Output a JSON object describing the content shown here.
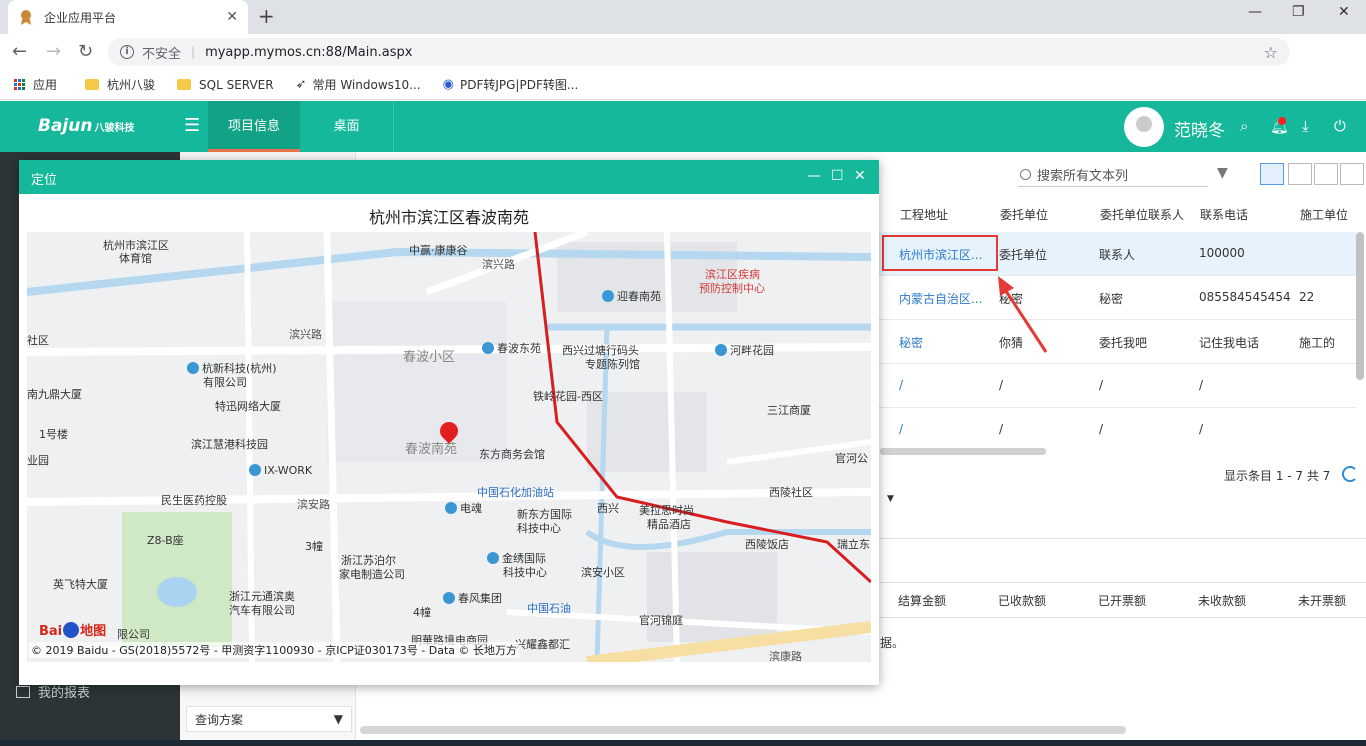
{
  "browser": {
    "tab_title": "企业应用平台",
    "new_tab": "+",
    "security_label": "不安全",
    "url": "myapp.mymos.cn:88/Main.aspx",
    "bookmarks": [
      {
        "label": "应用",
        "icon": "apps-grid-icon"
      },
      {
        "label": "杭州八骏",
        "icon": "folder-icon"
      },
      {
        "label": "SQL SERVER",
        "icon": "folder-icon"
      },
      {
        "label": "常用 Windows10...",
        "icon": "link-icon"
      },
      {
        "label": "PDF转JPG|PDF转图...",
        "icon": "pdf-site-icon"
      }
    ]
  },
  "header": {
    "logo_text": "Bajun",
    "logo_sub": "八骏科技",
    "tabs": [
      "项目信息",
      "桌面"
    ],
    "active_tab": "项目信息",
    "username": "范晓冬",
    "accent": "#15b89a"
  },
  "leftnav": {
    "report_item": "我的报表"
  },
  "secondpanel": {
    "query_select": "查询方案"
  },
  "toolbar": {
    "search_placeholder": "搜索所有文本列"
  },
  "table": {
    "columns": [
      "工程地址",
      "委托单位",
      "委托单位联系人",
      "联系电话",
      "施工单位"
    ],
    "rows": [
      [
        "杭州市滨江区...",
        "委托单位",
        "联系人",
        "100000",
        ""
      ],
      [
        "内蒙古自治区...",
        "秘密",
        "秘密",
        "085584545454",
        "22"
      ],
      [
        "秘密",
        "你猜",
        "委托我吧",
        "记住我电话",
        "施工的"
      ],
      [
        "/",
        "/",
        "/",
        "/",
        ""
      ],
      [
        "/",
        "/",
        "/",
        "/",
        ""
      ]
    ],
    "selected_row": 0,
    "page_info": "显示条目 1 - 7 共 7"
  },
  "summary": {
    "columns": [
      "结算金额",
      "已收款额",
      "已开票额",
      "未收款额",
      "未开票额"
    ],
    "empty_text": "据。"
  },
  "modal": {
    "title": "定位",
    "heading": "杭州市滨江区春波南苑",
    "map_labels": {
      "l1": "杭州市滨江区",
      "l1b": "体育馆",
      "l2": "中赢·康康谷",
      "l3": "滨兴路",
      "l4": "滨江区疾病",
      "l4b": "预防控制中心",
      "l5": "迎春南苑",
      "l6": "滨兴路",
      "l7": "社区",
      "l8": "春波小区",
      "l9": "春波东苑",
      "l10": "西兴过塘行码头",
      "l10b": "专题陈列馆",
      "l11": "河畔花园",
      "l12": "杭新科技(杭州)",
      "l12b": "有限公司",
      "l13": "南九鼎大厦",
      "l14": "铁岭花园-西区",
      "l15": "特迅网络大厦",
      "l16": "三江商厦",
      "l17": "1号楼",
      "l18": "滨江慧港科技园",
      "l19": "春波南苑",
      "l20": "东方商务会馆",
      "l21": "官河公",
      "l22": "业园",
      "l23": "IX-WORK",
      "l24": "中国石化加油站",
      "l25": "西兴",
      "l26": "美拉思时尚",
      "l26b": "精品酒店",
      "l27": "西陵社区",
      "l28": "民生医药控股",
      "l29": "滨安路",
      "l30": "电魂",
      "l31": "新东方国际",
      "l31b": "科技中心",
      "l32": "西陵饭店",
      "l33": "瑞立东",
      "l34": "Z8-B座",
      "l35": "3幢",
      "l36": "浙江苏泊尔",
      "l36b": "家电制造公司",
      "l37": "金绣国际",
      "l37b": "科技中心",
      "l38": "滨安小区",
      "l39": "英飞特大厦",
      "l40": "浙江元通滨奥",
      "l40b": "汽车有限公司",
      "l41": "春风集团",
      "l42": "4幢",
      "l43": "中国石油",
      "l44": "官河锦庭",
      "l45": "限公司",
      "l46": "明華路境电商园",
      "l47": "兴耀鑫都汇",
      "l48": "滨康路"
    },
    "baidu_logo": "Bai",
    "baidu_logo_suffix": "地图",
    "copyright": "© 2019 Baidu - GS(2018)5572号 - 甲测资字1100930 - 京ICP证030173号 - Data © 长地万方"
  }
}
